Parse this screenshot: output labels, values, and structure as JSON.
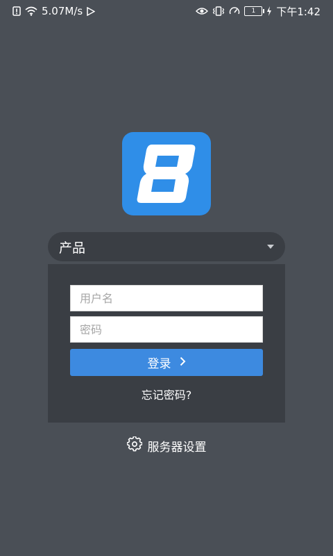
{
  "status_bar": {
    "speed": "5.07M/s",
    "battery_level": "1",
    "time": "下午1:42",
    "left_icons": [
      "alert-icon",
      "wifi-icon",
      "play-store-icon"
    ],
    "right_icons": [
      "eye-icon",
      "vibrate-icon",
      "speedometer-icon",
      "battery-icon",
      "charging-icon"
    ]
  },
  "logo": {
    "icon": "app-logo-8",
    "color": "#2f8ee8"
  },
  "product_select": {
    "selected": "产品"
  },
  "login": {
    "username_placeholder": "用户名",
    "password_placeholder": "密码",
    "login_label": "登录",
    "forgot_label": "忘记密码?"
  },
  "server_settings": {
    "label": "服务器设置",
    "icon": "gear-icon"
  },
  "colors": {
    "background": "#4a4f56",
    "panel": "#3a3e44",
    "accent": "#3d8ae0"
  }
}
